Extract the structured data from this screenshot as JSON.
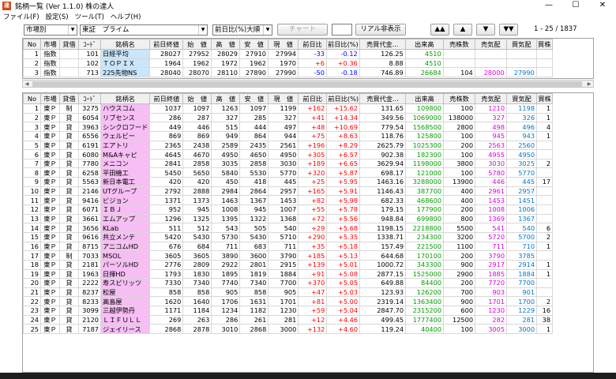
{
  "window": {
    "title": "銘柄一覧 (Ver 1.1.0)  株の達人",
    "icon_label": "達",
    "minimize": "—",
    "maximize": "☐",
    "close": "✕"
  },
  "menu": [
    "ファイル(F)",
    "設定(S)",
    "ツール(T)",
    "ヘルプ(H)"
  ],
  "toolbar": {
    "market_select": "市場別",
    "exchange_select": "東証　プライム",
    "sort_select": "前日比(%)大順",
    "chart_button": "チャート",
    "realtime_button": "リアル非表示",
    "first_button": "▲▲",
    "prev_button": "▲",
    "next_button": "▼",
    "last_button": "▼▼",
    "page_range": "1 -    25 / 1837"
  },
  "columns": [
    "No",
    "市場",
    "貸借",
    "ｺｰﾄﾞ",
    "銘柄名",
    "前日終値",
    "始　値",
    "高　値",
    "安　値",
    "現　値",
    "前日比",
    "前日比(%)",
    "売買代金...",
    "出来高",
    "売株数",
    "売気配",
    "買気配",
    "買株"
  ],
  "index_rows": [
    [
      "1",
      "指数",
      "",
      "101",
      "日経平均",
      "28027",
      "27952",
      "28029",
      "27910",
      "27994",
      "-33",
      "-0.12",
      "126.25",
      "4510",
      "",
      "",
      "",
      ""
    ],
    [
      "2",
      "指数",
      "",
      "102",
      "ＴＯＰＩＸ",
      "1964",
      "1962",
      "1972",
      "1962",
      "1970",
      "+6",
      "+0.36",
      "8.88",
      "4510",
      "",
      "",
      "",
      ""
    ],
    [
      "3",
      "指数",
      "",
      "713",
      "225先物NS",
      "28040",
      "28070",
      "28110",
      "27890",
      "27990",
      "-50",
      "-0.18",
      "746.89",
      "26684",
      "104",
      "28000",
      "27990",
      ""
    ]
  ],
  "stock_rows": [
    [
      "1",
      "東Ｐ",
      "制",
      "3275",
      "ハウスコム",
      "1037",
      "1097",
      "1263",
      "1097",
      "1199",
      "+162",
      "+15.62",
      "131.65",
      "109800",
      "100",
      "1210",
      "1198",
      "1"
    ],
    [
      "2",
      "東Ｐ",
      "貸",
      "6054",
      "リブセンス",
      "286",
      "287",
      "327",
      "285",
      "327",
      "+41",
      "+14.34",
      "349.56",
      "1069000",
      "138000",
      "327",
      "326",
      "1"
    ],
    [
      "3",
      "東Ｐ",
      "貸",
      "3963",
      "シンクロフード",
      "449",
      "446",
      "515",
      "444",
      "497",
      "+48",
      "+10.69",
      "779.54",
      "1568500",
      "2800",
      "498",
      "496",
      "4"
    ],
    [
      "4",
      "東Ｐ",
      "貸",
      "6556",
      "ウェルビー",
      "869",
      "869",
      "949",
      "864",
      "944",
      "+75",
      "+8.63",
      "118.76",
      "125800",
      "100",
      "945",
      "943",
      "1"
    ],
    [
      "5",
      "東Ｐ",
      "貸",
      "6191",
      "エアトリ",
      "2365",
      "2438",
      "2589",
      "2435",
      "2561",
      "+196",
      "+8.29",
      "2625.79",
      "1025300",
      "200",
      "2563",
      "2560",
      ""
    ],
    [
      "6",
      "東Ｐ",
      "貸",
      "6080",
      "M&Aキャピ",
      "4645",
      "4670",
      "4950",
      "4650",
      "4950",
      "+305",
      "+6.57",
      "902.38",
      "182300",
      "100",
      "4955",
      "4950",
      ""
    ],
    [
      "7",
      "東Ｐ",
      "貸",
      "7780",
      "メニコン",
      "2841",
      "2858",
      "3035",
      "2858",
      "3030",
      "+189",
      "+6.65",
      "3629.94",
      "1198000",
      "3800",
      "3030",
      "3025",
      "2"
    ],
    [
      "8",
      "東Ｐ",
      "貸",
      "6258",
      "平田機工",
      "5450",
      "5650",
      "5840",
      "5530",
      "5770",
      "+320",
      "+5.87",
      "698.17",
      "121000",
      "100",
      "5780",
      "5770",
      ""
    ],
    [
      "9",
      "東Ｐ",
      "貸",
      "5563",
      "新日本電工",
      "420",
      "420",
      "450",
      "418",
      "445",
      "+25",
      "+5.95",
      "1463.16",
      "3288000",
      "13900",
      "446",
      "445",
      "17"
    ],
    [
      "10",
      "東Ｐ",
      "貸",
      "2146",
      "UTグループ",
      "2792",
      "2888",
      "2984",
      "2864",
      "2957",
      "+165",
      "+5.91",
      "1146.43",
      "387700",
      "400",
      "2961",
      "2957",
      ""
    ],
    [
      "11",
      "東Ｐ",
      "貸",
      "9416",
      "ビジョン",
      "1371",
      "1373",
      "1463",
      "1367",
      "1453",
      "+82",
      "+5.98",
      "682.33",
      "468600",
      "400",
      "1453",
      "1451",
      ""
    ],
    [
      "12",
      "東Ｐ",
      "貸",
      "6071",
      "ＩＢＪ",
      "952",
      "945",
      "1008",
      "945",
      "1007",
      "+55",
      "+5.78",
      "179.15",
      "177900",
      "200",
      "1008",
      "1006",
      ""
    ],
    [
      "13",
      "東Ｐ",
      "貸",
      "3661",
      "エムアップ",
      "1296",
      "1325",
      "1395",
      "1322",
      "1368",
      "+72",
      "+5.56",
      "948.84",
      "699800",
      "800",
      "1369",
      "1367",
      ""
    ],
    [
      "14",
      "東Ｐ",
      "貸",
      "3656",
      "KLab",
      "511",
      "512",
      "543",
      "505",
      "540",
      "+29",
      "+5.68",
      "1198.15",
      "2218800",
      "5500",
      "541",
      "540",
      "6"
    ],
    [
      "15",
      "東Ｐ",
      "貸",
      "9616",
      "共立メンテ",
      "5420",
      "5430",
      "5730",
      "5430",
      "5710",
      "+290",
      "+5.35",
      "1338.71",
      "234300",
      "3200",
      "5720",
      "5700",
      "2"
    ],
    [
      "16",
      "東Ｐ",
      "貸",
      "8715",
      "アニコムHD",
      "676",
      "684",
      "711",
      "683",
      "711",
      "+35",
      "+5.18",
      "157.49",
      "221500",
      "1100",
      "711",
      "710",
      "1"
    ],
    [
      "17",
      "東Ｐ",
      "制",
      "7033",
      "MSOL",
      "3605",
      "3605",
      "3890",
      "3600",
      "3790",
      "+185",
      "+5.13",
      "644.68",
      "170100",
      "200",
      "3790",
      "3785",
      ""
    ],
    [
      "18",
      "東Ｐ",
      "貸",
      "2181",
      "パーソルHD",
      "2776",
      "2809",
      "2922",
      "2801",
      "2915",
      "+139",
      "+5.01",
      "1000.72",
      "343300",
      "900",
      "2917",
      "2914",
      "1"
    ],
    [
      "19",
      "東Ｐ",
      "貸",
      "1963",
      "日揮HD",
      "1793",
      "1830",
      "1895",
      "1819",
      "1884",
      "+91",
      "+5.08",
      "2877.15",
      "1525000",
      "2900",
      "1885",
      "1884",
      "1"
    ],
    [
      "20",
      "東Ｐ",
      "貸",
      "2222",
      "寿スピリッツ",
      "7330",
      "7340",
      "7740",
      "7340",
      "7700",
      "+370",
      "+5.05",
      "649.88",
      "84400",
      "200",
      "7720",
      "7700",
      ""
    ],
    [
      "21",
      "東Ｐ",
      "貸",
      "8237",
      "松屋",
      "858",
      "858",
      "905",
      "858",
      "905",
      "+47",
      "+5.03",
      "123.93",
      "126200",
      "700",
      "903",
      "901",
      ""
    ],
    [
      "22",
      "東Ｐ",
      "貸",
      "8233",
      "高島屋",
      "1620",
      "1640",
      "1706",
      "1631",
      "1701",
      "+81",
      "+5.00",
      "2319.14",
      "1363400",
      "900",
      "1701",
      "1700",
      "2"
    ],
    [
      "23",
      "東Ｐ",
      "貸",
      "3099",
      "三越伊勢丹",
      "1171",
      "1184",
      "1234",
      "1182",
      "1230",
      "+59",
      "+5.04",
      "2847.70",
      "2315200",
      "600",
      "1230",
      "1229",
      "16"
    ],
    [
      "24",
      "東Ｐ",
      "貸",
      "2120",
      "ＬＩＦＵＬＬ",
      "269",
      "263",
      "286",
      "261",
      "281",
      "+12",
      "+4.46",
      "499.45",
      "1777400",
      "12500",
      "282",
      "281",
      "38"
    ],
    [
      "25",
      "東Ｐ",
      "貸",
      "7187",
      "ジェイリース",
      "2868",
      "2878",
      "3010",
      "2868",
      "3000",
      "+132",
      "+4.60",
      "119.24",
      "40400",
      "100",
      "3005",
      "3000",
      "1"
    ]
  ],
  "colors": {
    "name_bg": "#f7bdf4",
    "index_name_bg": "#c9e6fb",
    "up": "#ff0000",
    "down": "#0000ff",
    "volume": "#00a000",
    "ask": "#e000e0",
    "bid": "#0078c8"
  }
}
